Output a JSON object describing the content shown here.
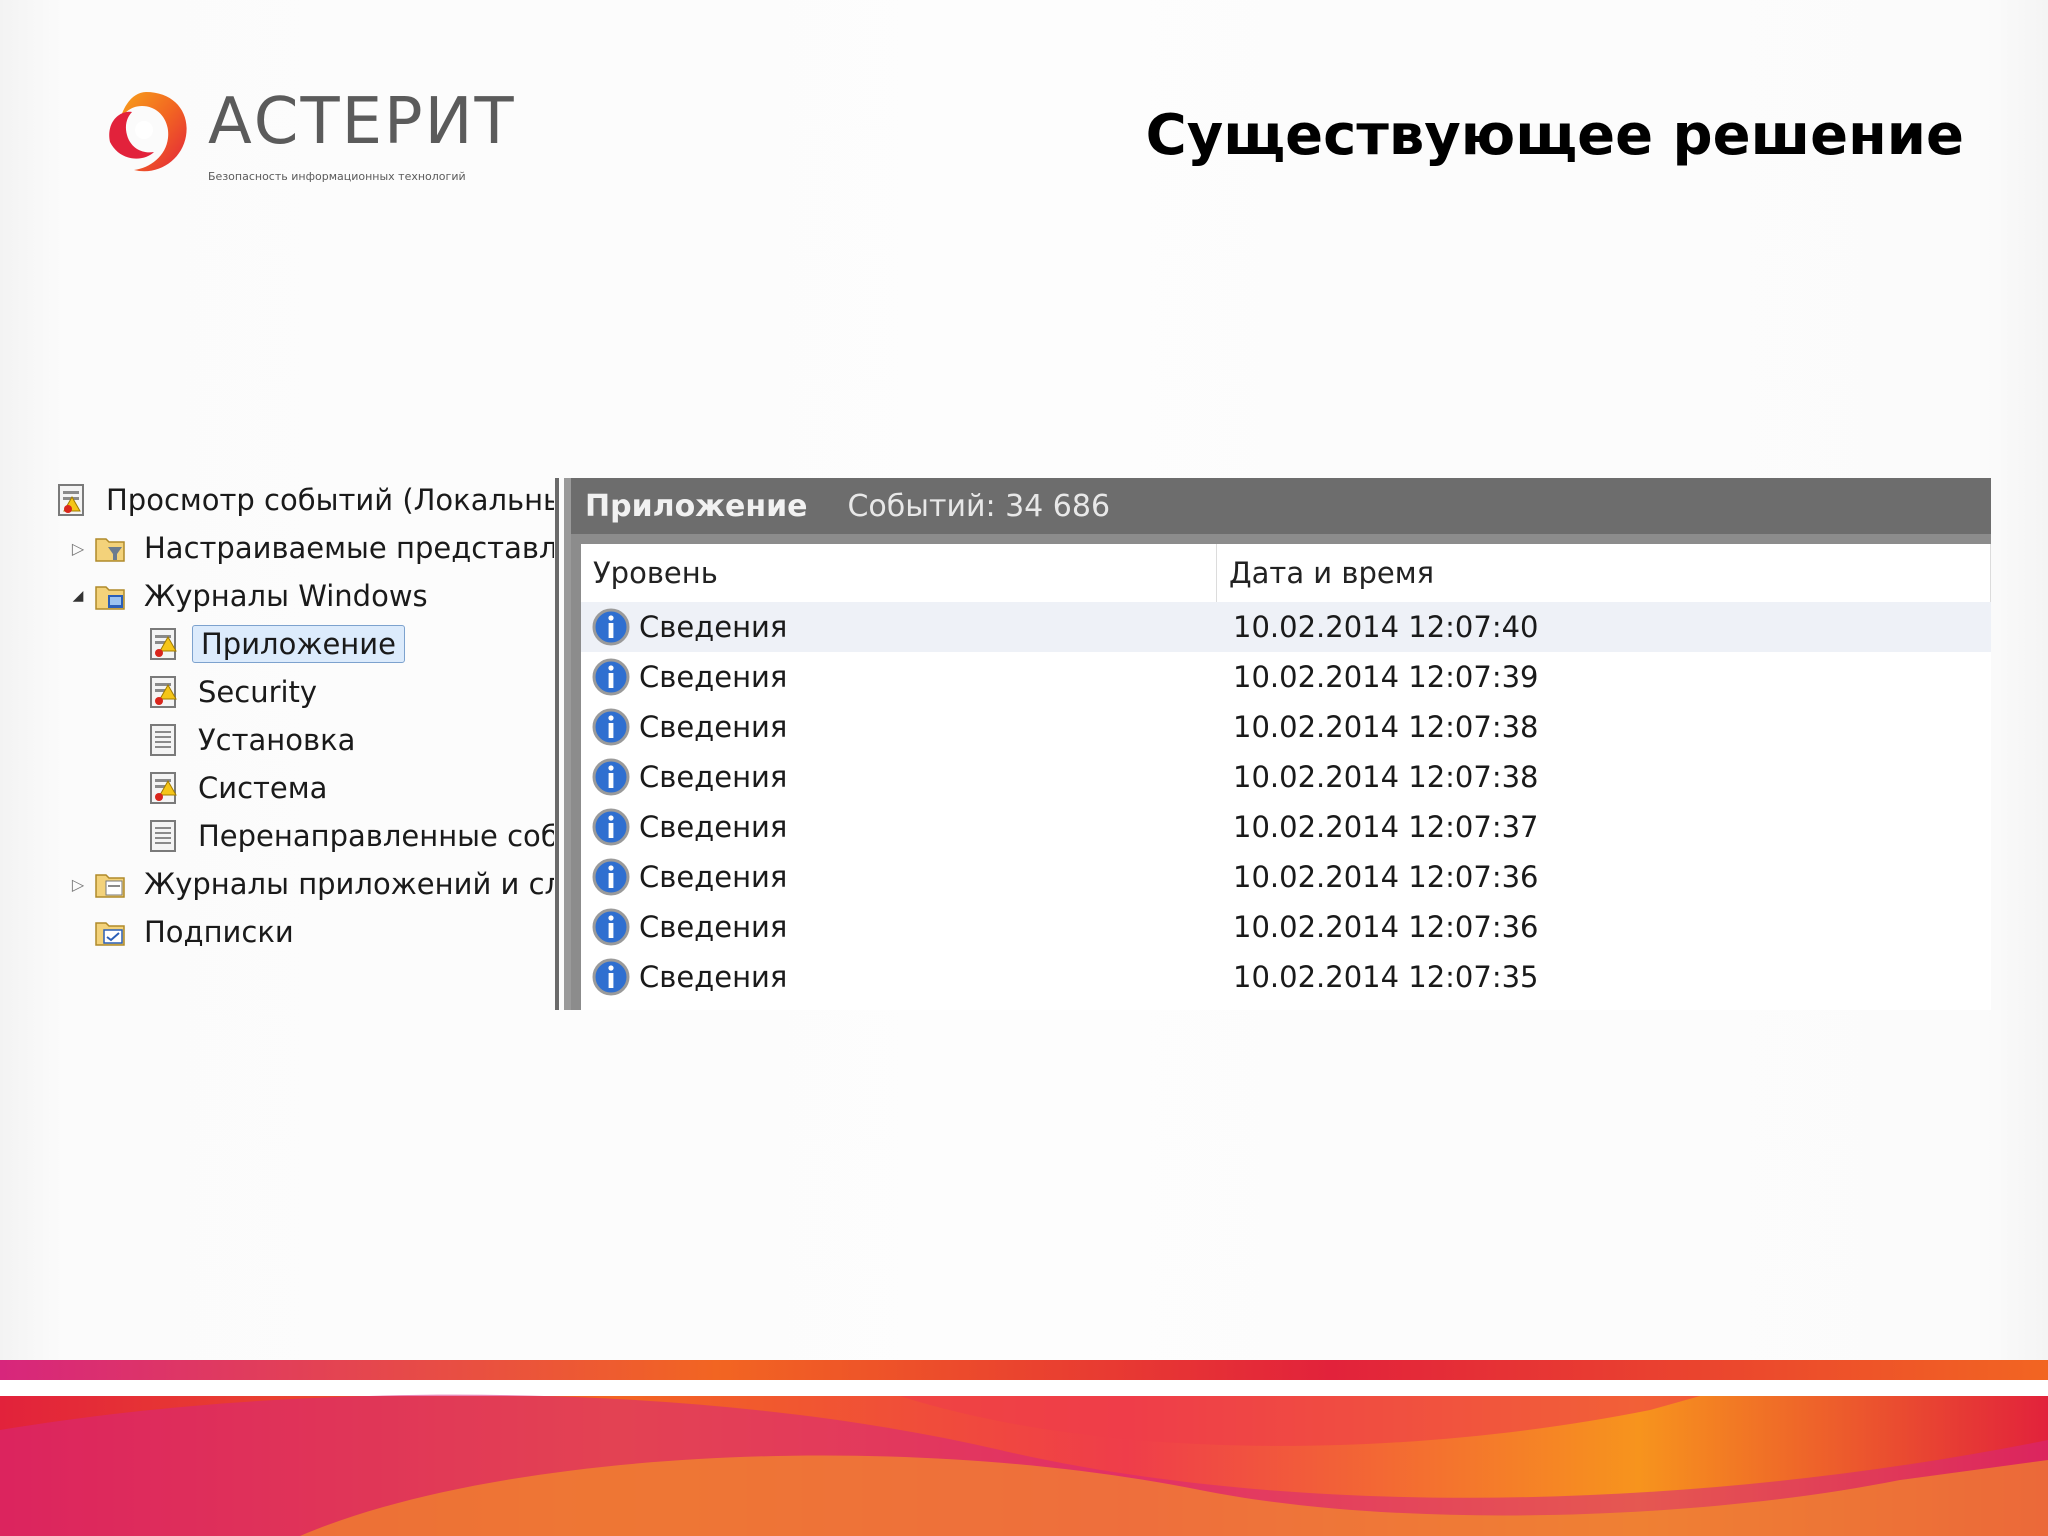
{
  "brand": {
    "name": "АСТЕРИТ",
    "tagline": "Безопасность информационных технологий",
    "colors": {
      "orange": "#f26522",
      "red": "#e2223b",
      "magenta": "#d7267c",
      "gray": "#5b5b5b"
    }
  },
  "slide": {
    "title": "Существующее решение"
  },
  "tree": {
    "root": "Просмотр событий (Локальны",
    "items": [
      {
        "label": "Настраиваемые представле",
        "expander": "▷",
        "icon": "filter-folder-icon"
      },
      {
        "label": "Журналы Windows",
        "expander": "◢",
        "icon": "windows-folder-icon"
      },
      {
        "label": "Приложение",
        "icon": "event-log-warning-icon",
        "selected": true
      },
      {
        "label": "Security",
        "icon": "event-log-warning-icon"
      },
      {
        "label": "Установка",
        "icon": "event-log-icon"
      },
      {
        "label": "Система",
        "icon": "event-log-warning-icon"
      },
      {
        "label": "Перенаправленные соб",
        "icon": "event-log-icon"
      },
      {
        "label": "Журналы приложений и сл",
        "expander": "▷",
        "icon": "folder-icon"
      },
      {
        "label": "Подписки",
        "icon": "subscriptions-icon"
      }
    ]
  },
  "pane": {
    "title": "Приложение",
    "count": "Событий: 34 686",
    "columns": [
      "Уровень",
      "Дата и время"
    ],
    "rows": [
      {
        "level": "Сведения",
        "datetime": "10.02.2014 12:07:40"
      },
      {
        "level": "Сведения",
        "datetime": "10.02.2014 12:07:39"
      },
      {
        "level": "Сведения",
        "datetime": "10.02.2014 12:07:38"
      },
      {
        "level": "Сведения",
        "datetime": "10.02.2014 12:07:38"
      },
      {
        "level": "Сведения",
        "datetime": "10.02.2014 12:07:37"
      },
      {
        "level": "Сведения",
        "datetime": "10.02.2014 12:07:36"
      },
      {
        "level": "Сведения",
        "datetime": "10.02.2014 12:07:36"
      },
      {
        "level": "Сведения",
        "datetime": "10.02.2014 12:07:35"
      }
    ]
  }
}
